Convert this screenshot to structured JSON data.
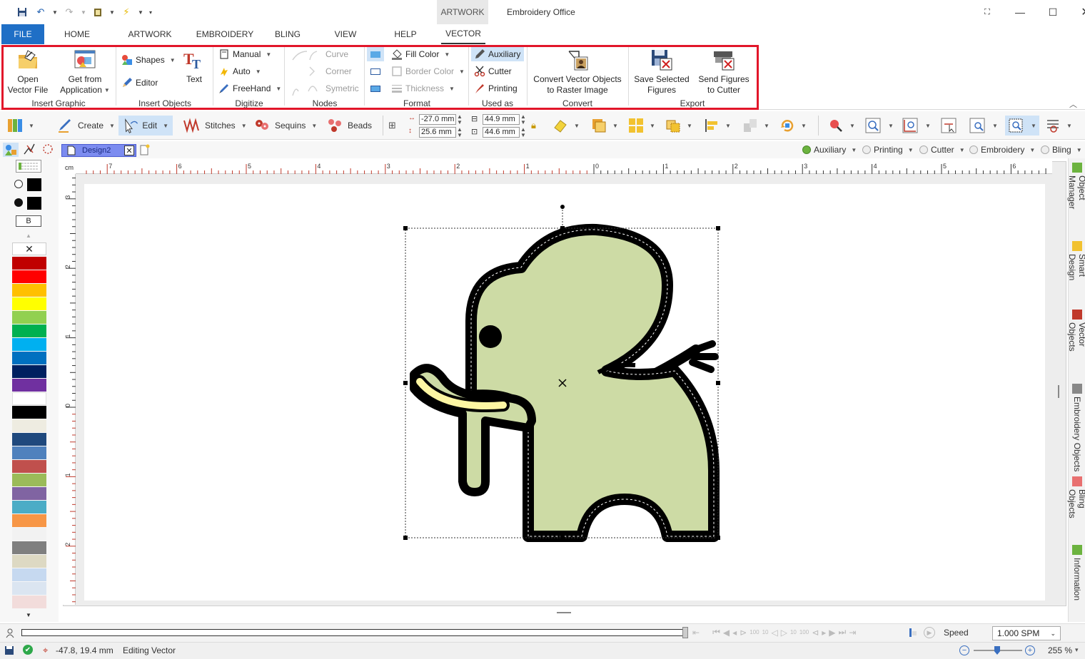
{
  "app": {
    "title": "Embroidery Office",
    "context_tab": "ARTWORK"
  },
  "menu_tabs": [
    "FILE",
    "HOME",
    "ARTWORK",
    "EMBROIDERY",
    "BLING",
    "VIEW",
    "HELP",
    "VECTOR"
  ],
  "ribbon": {
    "insert_graphic": {
      "label": "Insert Graphic",
      "open_vector_l1": "Open",
      "open_vector_l2": "Vector File",
      "get_from_app_l1": "Get from",
      "get_from_app_l2": "Application"
    },
    "insert_objects": {
      "label": "Insert Objects",
      "shapes": "Shapes",
      "editor": "Editor",
      "text": "Text"
    },
    "digitize": {
      "label": "Digitize",
      "manual": "Manual",
      "auto": "Auto",
      "freehand": "FreeHand"
    },
    "nodes": {
      "label": "Nodes",
      "curve": "Curve",
      "corner": "Corner",
      "symetric": "Symetric"
    },
    "format": {
      "label": "Format",
      "fill_color": "Fill Color",
      "border_color": "Border Color",
      "thickness": "Thickness"
    },
    "used_as": {
      "label": "Used as",
      "auxiliary": "Auxiliary",
      "cutter": "Cutter",
      "printing": "Printing"
    },
    "convert": {
      "label": "Convert",
      "convert_l1": "Convert Vector Objects",
      "convert_l2": "to Raster Image"
    },
    "export": {
      "label": "Export",
      "save_l1": "Save Selected",
      "save_l2": "Figures",
      "send_l1": "Send Figures",
      "send_l2": "to Cutter"
    }
  },
  "toolbar2": {
    "create": "Create",
    "edit": "Edit",
    "stitches": "Stitches",
    "sequins": "Sequins",
    "beads": "Beads",
    "pos_x": "-27.0 mm",
    "pos_y": "25.6 mm",
    "width": "44.9 mm",
    "height": "44.6 mm"
  },
  "document": {
    "tab_name": "Design2"
  },
  "layers": [
    "Auxiliary",
    "Printing",
    "Cutter",
    "Embroidery",
    "Bling"
  ],
  "ruler": {
    "unit": "cm",
    "top_labels": [
      "7",
      "6",
      "5",
      "4",
      "3",
      "2",
      "1",
      "0",
      "1",
      "2",
      "3",
      "4",
      "5",
      "6"
    ],
    "left_labels": [
      "3",
      "2",
      "1",
      "0",
      "1",
      "2"
    ]
  },
  "palette": {
    "bold_label": "B",
    "colors": [
      "#c00000",
      "#ff0000",
      "#ffc000",
      "#ffff00",
      "#92d050",
      "#00b050",
      "#00b0f0",
      "#0070c0",
      "#002060",
      "#7030a0",
      "#ffffff",
      "#000000",
      "#eeece1",
      "#1f497d",
      "#4f81bd",
      "#c0504d",
      "#9bbb59",
      "#8064a2",
      "#4bacc6",
      "#f79646",
      "#f2f2f2",
      "#7f7f7f",
      "#ddd9c3",
      "#c6d9f0",
      "#dbe5f1",
      "#f2dcdb"
    ]
  },
  "dock_tabs": [
    "Object Manager",
    "Smart Design",
    "Vector Objects",
    "Embroidery Objects",
    "Bling Objects",
    "Information"
  ],
  "playbar": {
    "speed_label": "Speed",
    "speed_value": "1.000 SPM",
    "step_labels": [
      "100",
      "10",
      "10",
      "100"
    ]
  },
  "status": {
    "coords": "-47.8, 19.4 mm",
    "mode": "Editing Vector",
    "zoom": "255 %"
  },
  "artwork": {
    "body_color": "#cddba5",
    "outline_color": "#000000",
    "tusk_color": "#fdf6a3"
  }
}
